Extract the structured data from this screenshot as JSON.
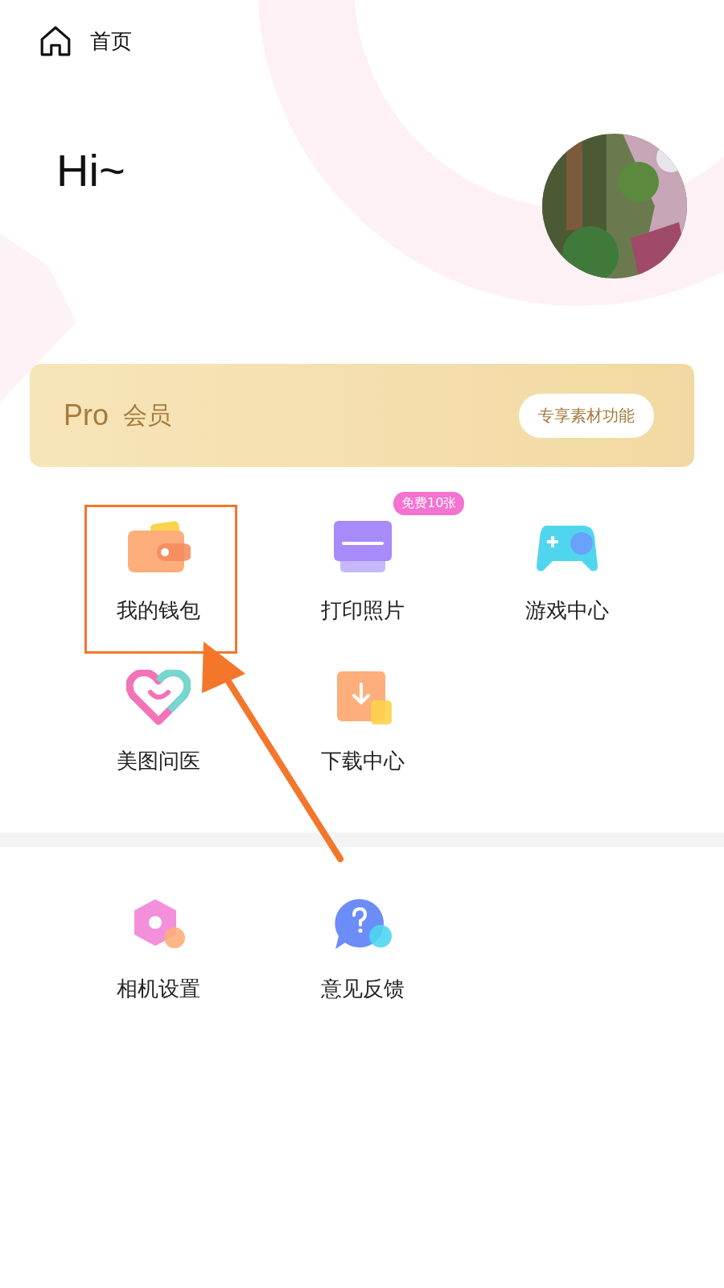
{
  "header": {
    "title": "首页"
  },
  "greeting": "Hi~",
  "pro_banner": {
    "title": "Pro",
    "subtitle": "会员",
    "button": "专享素材功能"
  },
  "services": [
    {
      "label": "我的钱包",
      "kind": "wallet",
      "highlighted": true
    },
    {
      "label": "打印照片",
      "kind": "print",
      "badge": "免费10张",
      "highlighted": false
    },
    {
      "label": "游戏中心",
      "kind": "game",
      "highlighted": false
    },
    {
      "label": "美图问医",
      "kind": "heart",
      "highlighted": false
    },
    {
      "label": "下载中心",
      "kind": "download",
      "highlighted": false
    }
  ],
  "settings": [
    {
      "label": "相机设置",
      "kind": "settings",
      "highlighted": false
    },
    {
      "label": "意见反馈",
      "kind": "feedback",
      "highlighted": false
    }
  ]
}
